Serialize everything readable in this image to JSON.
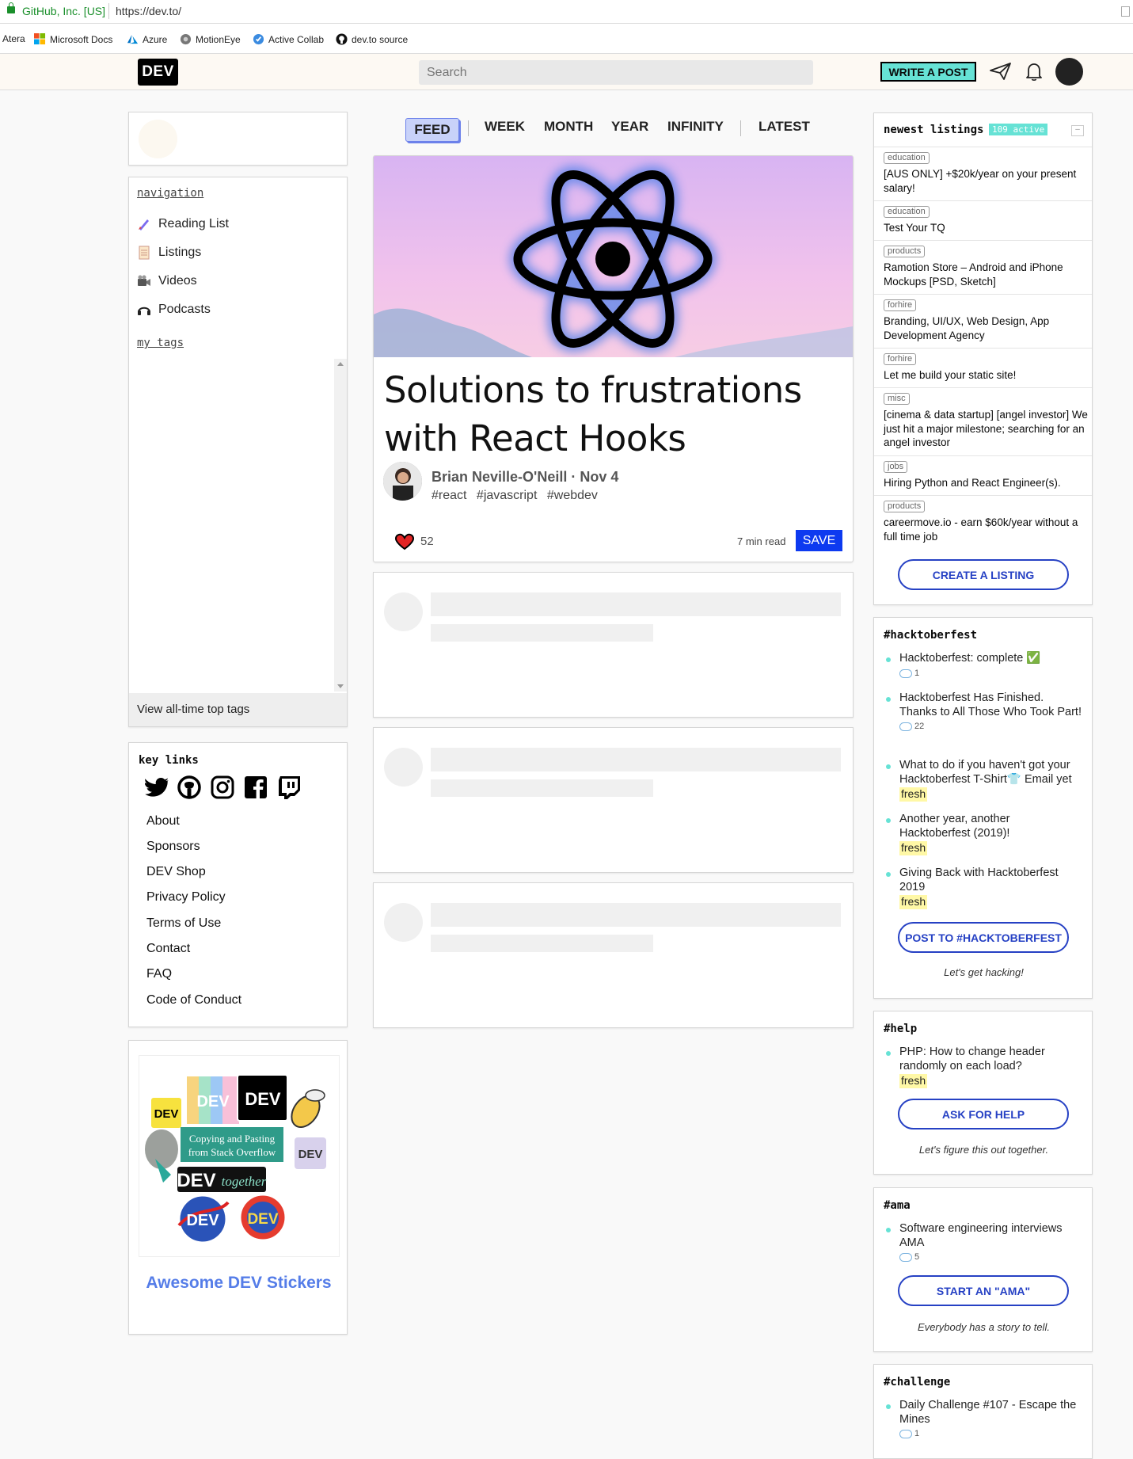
{
  "browser": {
    "site_identity": "GitHub, Inc. [US]",
    "url": "https://dev.to/",
    "bookmarks": [
      {
        "label": "Atera",
        "icon": "none"
      },
      {
        "label": "Microsoft Docs",
        "icon": "microsoft-icon"
      },
      {
        "label": "Azure",
        "icon": "azure-icon"
      },
      {
        "label": "MotionEye",
        "icon": "motioneye-icon"
      },
      {
        "label": "Active Collab",
        "icon": "activecollab-icon"
      },
      {
        "label": "dev.to source",
        "icon": "github-icon"
      }
    ]
  },
  "header": {
    "logo": "DEV",
    "search_placeholder": "Search",
    "write_post": "WRITE A POST"
  },
  "left": {
    "navigation_label": "navigation",
    "nav_items": [
      {
        "label": "Reading List",
        "icon": "reading-list-icon"
      },
      {
        "label": "Listings",
        "icon": "listings-icon"
      },
      {
        "label": "Videos",
        "icon": "videos-icon"
      },
      {
        "label": "Podcasts",
        "icon": "podcasts-icon"
      }
    ],
    "my_tags_label": "my tags",
    "view_all_tags": "View all-time top tags",
    "key_links_title": "key links",
    "key_links": [
      "About",
      "Sponsors",
      "DEV Shop",
      "Privacy Policy",
      "Terms of Use",
      "Contact",
      "FAQ",
      "Code of Conduct"
    ],
    "stickers_title": "Awesome DEV Stickers"
  },
  "sticker_text": {
    "dev": "DEV",
    "copy_line1": "Copying and Pasting",
    "copy_line2": "from Stack Overflow",
    "together": "together"
  },
  "feed": {
    "tabs": [
      "FEED",
      "WEEK",
      "MONTH",
      "YEAR",
      "INFINITY",
      "LATEST"
    ],
    "active_tab": "FEED",
    "post": {
      "title": "Solutions to frustrations with React Hooks",
      "author": "Brian Neville-O'Neill",
      "date": "Nov 4",
      "tags": [
        "#react",
        "#javascript",
        "#webdev"
      ],
      "reactions": "52",
      "read_time": "7 min read",
      "save_label": "SAVE"
    }
  },
  "right": {
    "listings": {
      "title": "newest listings",
      "badge": "109 active",
      "minimize": "–",
      "items": [
        {
          "category": "education",
          "title": "[AUS ONLY] +$20k/year on your present salary!"
        },
        {
          "category": "education",
          "title": "Test Your TQ"
        },
        {
          "category": "products",
          "title": "Ramotion Store – Android and iPhone Mockups [PSD, Sketch]"
        },
        {
          "category": "forhire",
          "title": "Branding, UI/UX, Web Design, App Development Agency"
        },
        {
          "category": "forhire",
          "title": "Let me build your static site!"
        },
        {
          "category": "misc",
          "title": "[cinema & data startup] [angel investor] We just hit a major milestone; searching for an angel investor"
        },
        {
          "category": "jobs",
          "title": "Hiring Python and React Engineer(s)."
        },
        {
          "category": "products",
          "title": "careermove.io - earn $60k/year without a full time job"
        }
      ],
      "create_button": "CREATE A LISTING"
    },
    "hacktoberfest": {
      "title": "#hacktoberfest",
      "items": [
        {
          "title": "Hacktoberfest: complete ✅",
          "comments": "1",
          "fresh": ""
        },
        {
          "title": "Hacktoberfest Has Finished. Thanks to All Those Who Took Part!",
          "comments": "22",
          "fresh": ""
        },
        {
          "title": "What to do if you haven't got your Hacktoberfest T-Shirt👕 Email yet",
          "comments": "",
          "fresh": "fresh"
        },
        {
          "title": "Another year, another Hacktoberfest (2019)!",
          "comments": "",
          "fresh": "fresh"
        },
        {
          "title": "Giving Back with Hacktoberfest 2019",
          "comments": "",
          "fresh": "fresh"
        }
      ],
      "button": "POST TO #HACKTOBERFEST",
      "tagline": "Let's get hacking!"
    },
    "help": {
      "title": "#help",
      "items": [
        {
          "title": "PHP: How to change header randomly on each load?",
          "comments": "",
          "fresh": "fresh"
        }
      ],
      "button": "ASK FOR HELP",
      "tagline": "Let's figure this out together."
    },
    "ama": {
      "title": "#ama",
      "items": [
        {
          "title": "Software engineering interviews AMA",
          "comments": "5",
          "fresh": ""
        }
      ],
      "button": "START AN \"AMA\"",
      "tagline": "Everybody has a story to tell."
    },
    "challenge": {
      "title": "#challenge",
      "items": [
        {
          "title": "Daily Challenge #107 - Escape the Mines",
          "comments": "1",
          "fresh": ""
        }
      ]
    }
  },
  "colors": {
    "accent_teal": "#66e2d5",
    "primary_blue": "#0d3af0",
    "button_blue": "#2641c4",
    "header_bg": "#fdf9f3",
    "page_bg": "#f9f9f9"
  }
}
